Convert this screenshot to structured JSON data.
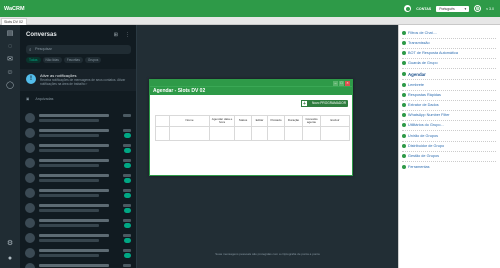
{
  "app": {
    "title": "WaCRM",
    "connect_label": "CONTAS",
    "language": "Português",
    "version": "v 3.0"
  },
  "tab": {
    "label": "Slots DV 02"
  },
  "chat": {
    "title": "Conversas",
    "search_placeholder": "Pesquisar",
    "filters": [
      "Todas",
      "Não lidas",
      "Favoritas",
      "Grupos"
    ],
    "notification_title": "Ative as notificações",
    "notification_body": "Receba notificações de mensagens de seus contatos. Ativar notificações na área de trabalho ›",
    "archived_label": "Arquivadas"
  },
  "main": {
    "footer_text": "Suas mensagens pessoais são protegidas com a criptografia de ponta a ponta"
  },
  "dialog": {
    "title": "Agendar - Slots DV 02",
    "new_button": "Novo PROGRAMADOR",
    "columns": [
      "Nome",
      "Agendar data e hora",
      "Status",
      "Editar",
      "Postado",
      "Duração",
      "Conexão agente",
      "Excluir"
    ]
  },
  "menu": {
    "items": [
      "Filtros de Chat....",
      "Transmissão",
      "BOT de Resposta Automática",
      "Guarda de Grupo",
      "Agendar",
      "Lembrete",
      "Respostas Rápidas",
      "Extrator de Dados",
      "WhatsApp Number Filter",
      "Utilitários do Grupo...",
      "Unirão de Grupos",
      "Distribuidor de Grupo",
      "Gestão de Grupos",
      "Ferramentas"
    ],
    "active_index": 4
  },
  "colors": {
    "brand": "#2e9a48",
    "chat_bg": "#111b21",
    "accent": "#00a884"
  }
}
